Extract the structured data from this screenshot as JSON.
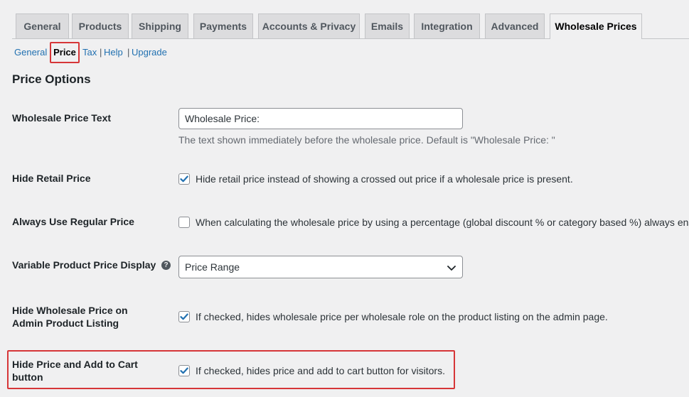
{
  "tabs": [
    {
      "label": "General"
    },
    {
      "label": "Products"
    },
    {
      "label": "Shipping"
    },
    {
      "label": "Payments"
    },
    {
      "label": "Accounts & Privacy"
    },
    {
      "label": "Emails"
    },
    {
      "label": "Integration"
    },
    {
      "label": "Advanced"
    },
    {
      "label": "Wholesale Prices",
      "active": true
    }
  ],
  "subnav": {
    "general": "General",
    "price": "Price",
    "tax": "Tax",
    "separator": "|",
    "help": "Help",
    "upgrade": "Upgrade"
  },
  "section_title": "Price Options",
  "fields": {
    "wholesale_price_text": {
      "label": "Wholesale Price Text",
      "value": "Wholesale Price:",
      "description": "The text shown immediately before the wholesale price. Default is \"Wholesale Price: \""
    },
    "hide_retail_price": {
      "label": "Hide Retail Price",
      "checked": true,
      "text": "Hide retail price instead of showing a crossed out price if a wholesale price is present."
    },
    "always_use_regular_price": {
      "label": "Always Use Regular Price",
      "checked": false,
      "text": "When calculating the wholesale price by using a percentage (global discount % or category based %) always ensu"
    },
    "variable_price_display": {
      "label": "Variable Product Price Display",
      "help_icon": "?",
      "selected": "Price Range"
    },
    "hide_wholesale_admin": {
      "label_line1": "Hide Wholesale Price on",
      "label_line2": "Admin Product Listing",
      "checked": true,
      "text": "If checked, hides wholesale price per wholesale role on the product listing on the admin page."
    },
    "hide_price_add_to_cart": {
      "label_line1": "Hide Price and Add to Cart",
      "label_line2": "button",
      "checked": true,
      "text": "If checked, hides price and add to cart button for visitors."
    }
  },
  "colors": {
    "link": "#2271b1",
    "highlight": "#d63638",
    "checkmark": "#2271b1",
    "background": "#f0f0f1"
  }
}
